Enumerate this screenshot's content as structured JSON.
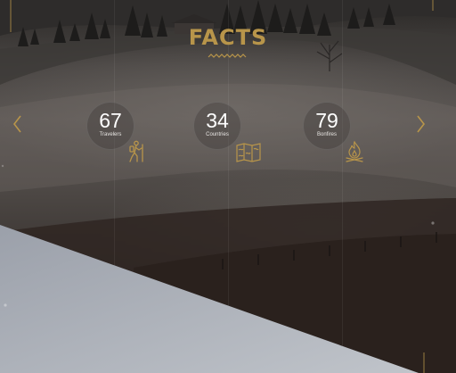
{
  "section": {
    "title": "FACTS"
  },
  "colors": {
    "accent": "#b8954a",
    "text": "#ffffff",
    "panel": "#a9adb5"
  },
  "stats": [
    {
      "number": "67",
      "label": "Travelers",
      "icon": "hiker-icon"
    },
    {
      "number": "34",
      "label": "Countries",
      "icon": "map-icon"
    },
    {
      "number": "79",
      "label": "Bonfires",
      "icon": "campfire-icon"
    }
  ],
  "nav": {
    "prev_icon": "chevron-left-icon",
    "next_icon": "chevron-right-icon"
  }
}
